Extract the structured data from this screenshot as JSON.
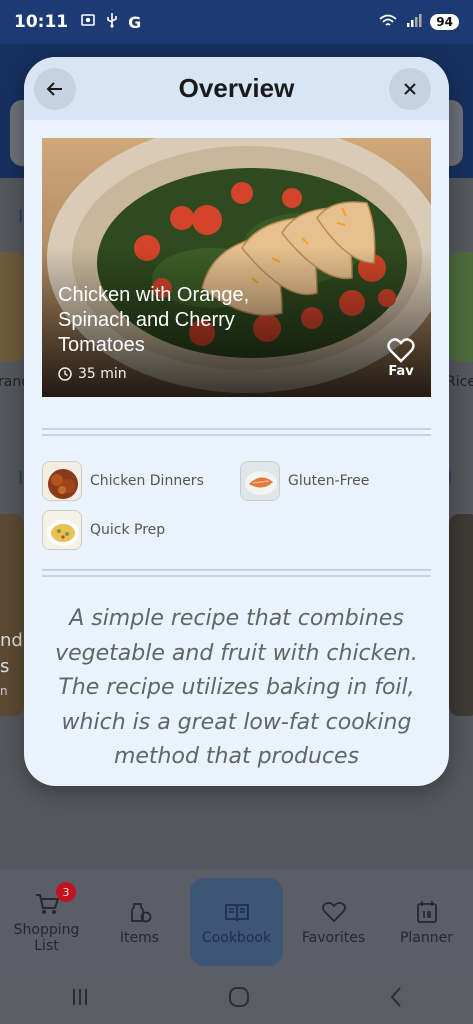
{
  "status_bar": {
    "time": "10:11",
    "left_icons": [
      "screenshot-icon",
      "usb-icon",
      "google-icon"
    ],
    "battery": "94"
  },
  "modal": {
    "title": "Overview",
    "back_icon": "arrow-left-icon",
    "close_icon": "close-icon",
    "recipe": {
      "title": "Chicken with Orange, Spinach and Cherry Tomatoes",
      "time": "35 min",
      "fav_label": "Fav"
    },
    "tags": [
      {
        "label": "Chicken Dinners",
        "icon": "chicken-dish-thumbnail"
      },
      {
        "label": "Gluten-Free",
        "icon": "salmon-dish-thumbnail"
      },
      {
        "label": "Quick Prep",
        "icon": "pasta-dish-thumbnail"
      }
    ],
    "description": "A simple recipe that combines vegetable and fruit with chicken. The recipe utilizes baking in foil, which is a great low-fat cooking method that produces"
  },
  "background": {
    "left_fragments": [
      "ranc",
      "nd",
      "s",
      "n"
    ],
    "right_fragment": "Rice"
  },
  "bottom_nav": {
    "items": [
      {
        "label": "Shopping List",
        "icon": "cart-icon",
        "badge": "3"
      },
      {
        "label": "Items",
        "icon": "items-icon"
      },
      {
        "label": "Cookbook",
        "icon": "book-icon",
        "active": true
      },
      {
        "label": "Favorites",
        "icon": "heart-icon"
      },
      {
        "label": "Planner",
        "icon": "calendar-icon"
      }
    ]
  },
  "colors": {
    "status_bar": "#1c3a74",
    "modal_bg": "#eaf2fb",
    "modal_header": "#d7e5f4",
    "badge": "#c1121f"
  }
}
